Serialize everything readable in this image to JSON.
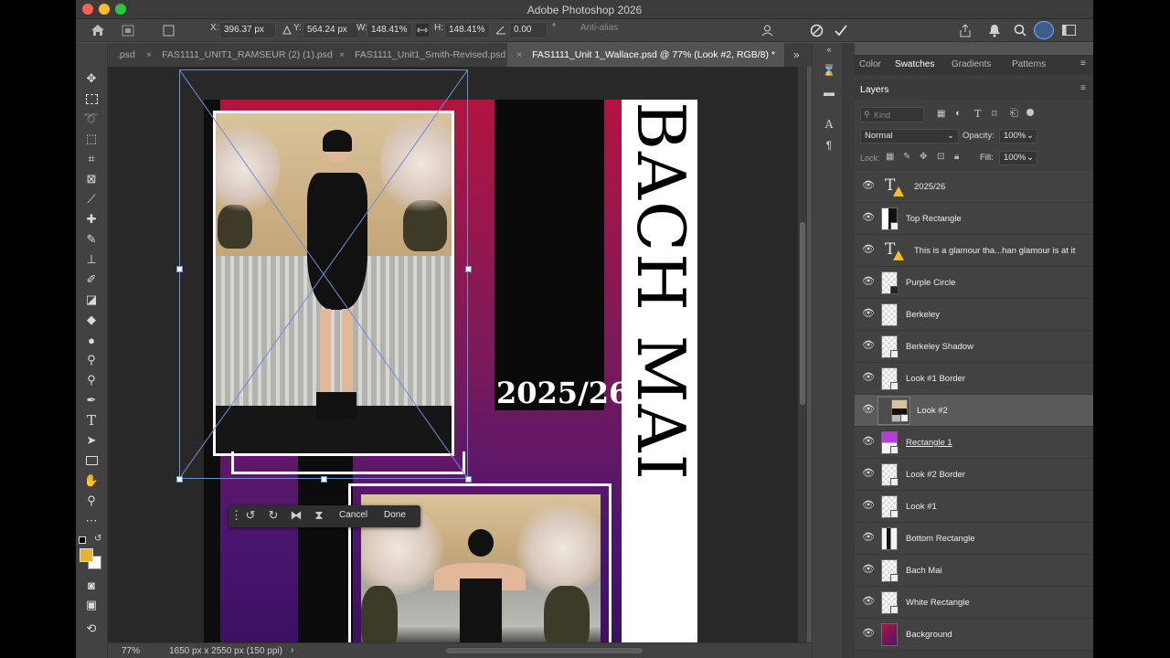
{
  "app": {
    "title": "Adobe Photoshop 2026"
  },
  "options_bar": {
    "x_label": "X:",
    "x_value": "396.37 px",
    "y_label": "Y:",
    "y_value": "564.24 px",
    "w_label": "W:",
    "w_value": "148.41%",
    "h_label": "H:",
    "h_value": "148.41%",
    "angle_value": "0.00",
    "angle_unit": "°",
    "antialias": "Anti-alias"
  },
  "doc_tabs": [
    {
      "label": ".psd",
      "close": ""
    },
    {
      "label": "FAS1111_UNIT1_RAMSEUR (2) (1).psd",
      "close": "×"
    },
    {
      "label": "FAS1111_Unit1_Smith-Revised.psd",
      "close": "×"
    },
    {
      "label": "FAS1111_Unit 1_Wallace.psd @ 77% (Look #2, RGB/8) *",
      "close": "×"
    }
  ],
  "canvas": {
    "vertical_title": "BACH MAI",
    "year": "2025/26"
  },
  "transform_bar": {
    "cancel": "Cancel",
    "done": "Done"
  },
  "status_bar": {
    "zoom": "77%",
    "doc_info": "1650 px x 2550 px (150 ppi)",
    "arrow": "›"
  },
  "panel_tabs": [
    "Color",
    "Swatches",
    "Gradients",
    "Patterns"
  ],
  "layers_panel": {
    "title": "Layers",
    "filter_placeholder": "Kind",
    "blend_mode": "Normal",
    "opacity_label": "Opacity:",
    "opacity_value": "100%",
    "lock_label": "Lock:",
    "fill_label": "Fill:",
    "fill_value": "100%",
    "layers": [
      {
        "name": "2025/26",
        "type": "text",
        "warning": true
      },
      {
        "name": "Top Rectangle",
        "type": "shape"
      },
      {
        "name": "This is a glamour tha...han glamour is at it",
        "type": "text",
        "warning": true
      },
      {
        "name": "Purple Circle",
        "type": "shape"
      },
      {
        "name": "Berkeley",
        "type": "raster"
      },
      {
        "name": "Berkeley Shadow",
        "type": "raster"
      },
      {
        "name": "Look #1 Border",
        "type": "shape"
      },
      {
        "name": "Look #2",
        "type": "smart",
        "selected": true
      },
      {
        "name": "Rectangle 1",
        "type": "shape",
        "underline": true
      },
      {
        "name": "Look #2 Border",
        "type": "shape"
      },
      {
        "name": "Look #1",
        "type": "smart"
      },
      {
        "name": "Bottom Rectangle",
        "type": "shape"
      },
      {
        "name": "Bach Mai",
        "type": "smart"
      },
      {
        "name": "White Rectangle",
        "type": "shape"
      },
      {
        "name": "Background",
        "type": "raster"
      }
    ]
  },
  "colors": {
    "foreground": "#e8b32c",
    "background": "#ffffff",
    "accent_selection": "#6f8fd4",
    "warning": "#f2c21b"
  },
  "icons": {
    "toolbar": [
      "move-icon",
      "marquee-icon",
      "lasso-icon",
      "object-select-icon",
      "crop-icon",
      "frame-icon",
      "eyedropper-icon",
      "healing-icon",
      "brush-icon",
      "clone-stamp-icon",
      "history-brush-icon",
      "eraser-icon",
      "paint-bucket-icon",
      "blur-icon",
      "dodge-icon",
      "pen-icon",
      "type-icon",
      "path-select-icon",
      "rectangle-icon",
      "hand-icon",
      "zoom-icon",
      "more-tools-icon"
    ]
  }
}
